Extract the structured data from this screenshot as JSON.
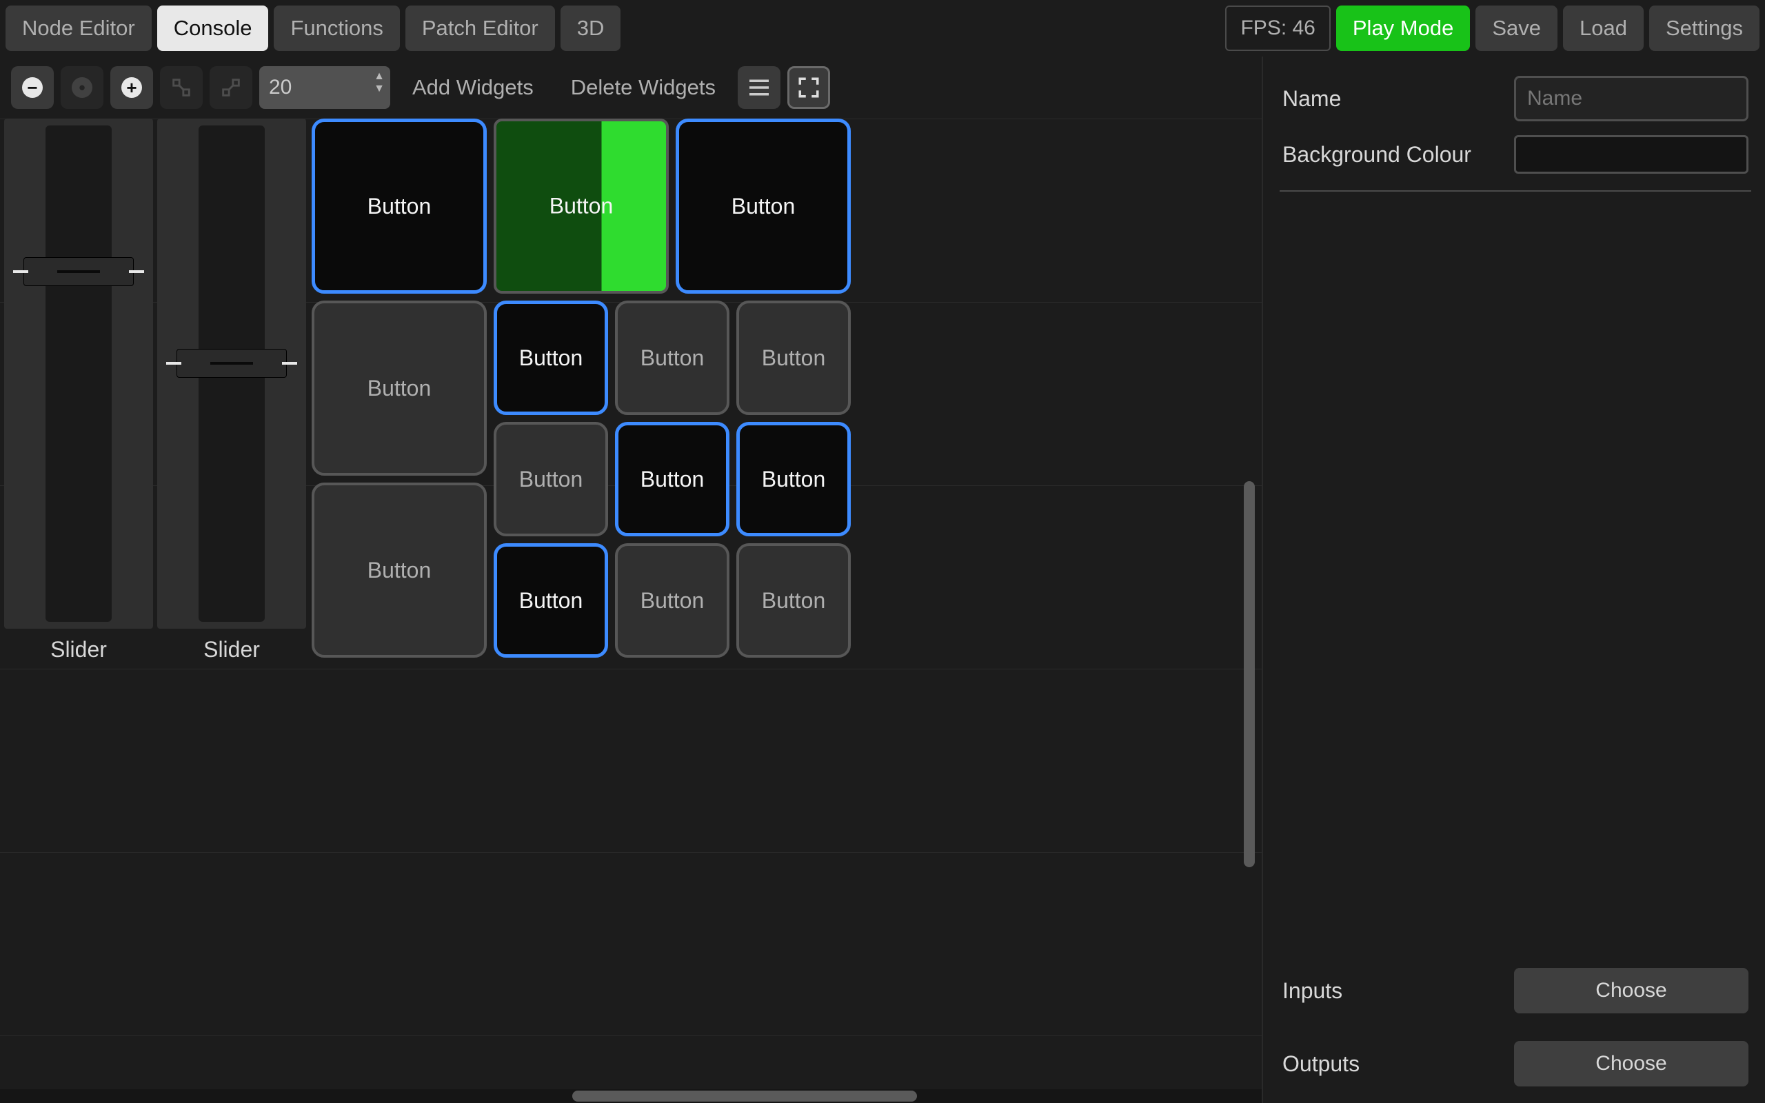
{
  "header": {
    "tabs": [
      {
        "label": "Node Editor",
        "active": false
      },
      {
        "label": "Console",
        "active": true
      },
      {
        "label": "Functions",
        "active": false
      },
      {
        "label": "Patch Editor",
        "active": false
      },
      {
        "label": "3D",
        "active": false
      }
    ],
    "fps_label": "FPS: 46",
    "play_mode": "Play Mode",
    "save": "Save",
    "load": "Load",
    "settings": "Settings"
  },
  "toolbar": {
    "zoom_out_icon": "zoom-out-icon",
    "zoom_reset_icon": "zoom-reset-icon",
    "zoom_in_icon": "zoom-in-icon",
    "grid_snap_icon_1": "grid-snap-a-icon",
    "grid_snap_icon_2": "grid-snap-b-icon",
    "grid_size_value": "20",
    "add_widgets": "Add Widgets",
    "delete_widgets": "Delete Widgets",
    "menu_icon": "hamburger-icon",
    "fit_icon": "fit-view-icon"
  },
  "canvas": {
    "sliders": [
      {
        "label": "Slider",
        "pos_pct": 30
      },
      {
        "label": "Slider",
        "pos_pct": 48
      }
    ],
    "buttons_row1": [
      {
        "label": "Button",
        "state": "selected"
      },
      {
        "label": "Button",
        "state": "green-half"
      },
      {
        "label": "Button",
        "state": "selected"
      }
    ],
    "btn_big_left": {
      "label": "Button",
      "state": "normal"
    },
    "btn_r2": [
      {
        "label": "Button",
        "state": "selected"
      },
      {
        "label": "Button",
        "state": "normal"
      },
      {
        "label": "Button",
        "state": "normal"
      }
    ],
    "btn_r3": [
      {
        "label": "Button",
        "state": "normal"
      },
      {
        "label": "Button",
        "state": "selected"
      },
      {
        "label": "Button",
        "state": "selected"
      }
    ],
    "btn_big_left2": {
      "label": "Button",
      "state": "normal"
    },
    "btn_r4": [
      {
        "label": "Button",
        "state": "selected"
      },
      {
        "label": "Button",
        "state": "normal"
      },
      {
        "label": "Button",
        "state": "normal"
      }
    ]
  },
  "inspector": {
    "name_label": "Name",
    "name_placeholder": "Name",
    "bg_colour_label": "Background Colour",
    "inputs_label": "Inputs",
    "outputs_label": "Outputs",
    "choose_label": "Choose"
  }
}
